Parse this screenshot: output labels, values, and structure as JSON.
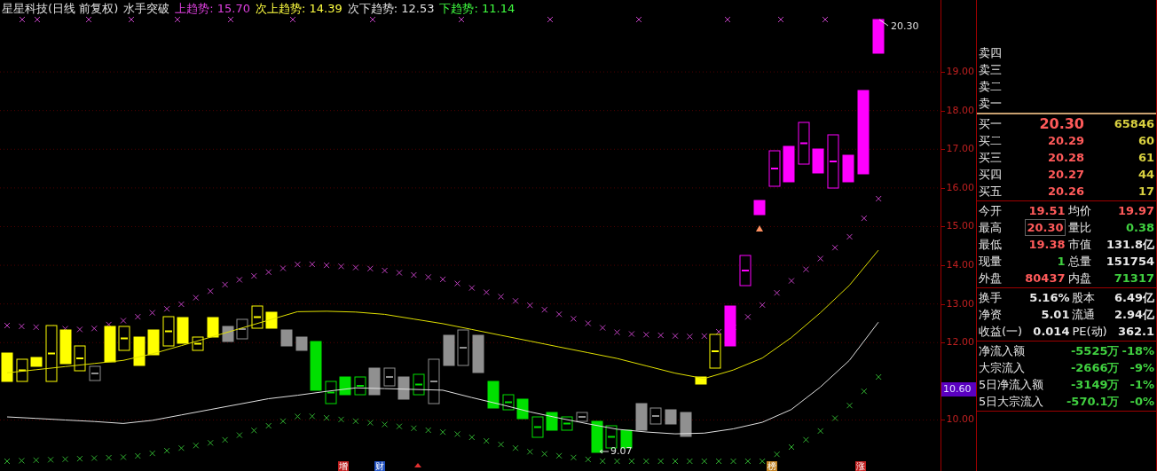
{
  "title": {
    "stock": "星星科技(日线 前复权)",
    "indicator": "水手突破",
    "legend": [
      {
        "text": "上趋势: 15.70",
        "color": "#e040e0"
      },
      {
        "text": "次上趋势: 14.39",
        "color": "#ffff40"
      },
      {
        "text": "次下趋势: 12.53",
        "color": "#e0e0e0"
      },
      {
        "text": "下趋势: 11.14",
        "color": "#40ff40"
      }
    ]
  },
  "chart": {
    "chart_data": {
      "type": "line",
      "grid": true,
      "ylim": [
        8.68,
        20.86
      ],
      "yticks": [
        {
          "value": 19,
          "label": "19.00"
        },
        {
          "value": 18,
          "label": "18.00"
        },
        {
          "value": 17,
          "label": "17.00"
        },
        {
          "value": 16,
          "label": "16.00"
        },
        {
          "value": 15,
          "label": "15.00"
        },
        {
          "value": 14,
          "label": "14.00"
        },
        {
          "value": 13,
          "label": "13.00"
        },
        {
          "value": 12,
          "label": "12.00"
        },
        {
          "value": 10,
          "label": "10.00"
        }
      ],
      "categories": [
        null,
        null,
        null,
        null,
        null,
        null,
        null,
        null,
        null,
        null,
        null,
        null,
        null,
        null,
        null,
        null,
        null,
        null,
        null,
        null,
        null,
        null,
        null,
        null,
        null,
        null,
        null,
        null,
        null,
        null,
        null
      ],
      "series": [
        {
          "color": "#e0e000",
          "values": [
            11.22,
            11.3,
            11.38,
            11.46,
            11.54,
            11.71,
            11.92,
            12.14,
            12.36,
            12.58,
            12.8,
            12.81,
            12.79,
            12.73,
            12.61,
            12.49,
            12.34,
            12.19,
            12.04,
            11.89,
            11.74,
            11.59,
            11.4,
            11.21,
            11.07,
            11.29,
            11.6,
            12.13,
            12.77,
            13.48,
            14.39
          ]
        },
        {
          "color": "#e0e0e0",
          "values": [
            10.08,
            10.04,
            10.0,
            9.96,
            9.91,
            9.99,
            10.13,
            10.27,
            10.41,
            10.55,
            10.64,
            10.74,
            10.83,
            10.81,
            10.79,
            10.77,
            10.58,
            10.4,
            10.21,
            10.05,
            9.9,
            9.76,
            9.69,
            9.64,
            9.66,
            9.77,
            9.94,
            10.27,
            10.85,
            11.54,
            12.53
          ]
        }
      ]
    },
    "annotations": [
      {
        "text": "20.30",
        "kind": "high"
      },
      {
        "text": "9.07",
        "kind": "low"
      }
    ],
    "markers": [
      {
        "text": "增",
        "color": "#c02020"
      },
      {
        "text": "财",
        "color": "#2050c0"
      },
      {
        "text": "榜",
        "color": "#c08020"
      },
      {
        "text": "涨",
        "color": "#c02020"
      }
    ]
  },
  "price_axis": {
    "current_price": "10.60"
  },
  "quote": {
    "sell": [
      "卖四",
      "卖三",
      "卖二",
      "卖一"
    ],
    "buy": [
      {
        "label": "买一",
        "price": "20.30",
        "volume": "65846"
      },
      {
        "label": "买二",
        "price": "20.29",
        "volume": "60"
      },
      {
        "label": "买三",
        "price": "20.28",
        "volume": "61"
      },
      {
        "label": "买四",
        "price": "20.27",
        "volume": "44"
      },
      {
        "label": "买五",
        "price": "20.26",
        "volume": "17"
      }
    ],
    "stats": [
      {
        "label": "今开",
        "value": "19.51",
        "color": "#ff5a5a",
        "boxed": false
      },
      {
        "label": "均价",
        "value": "19.97",
        "color": "#ff5a5a",
        "boxed": false
      },
      {
        "label": "最高",
        "value": "20.30",
        "color": "#ff5a5a",
        "boxed": true
      },
      {
        "label": "量比",
        "value": "0.38",
        "color": "#40d040",
        "boxed": false
      },
      {
        "label": "最低",
        "value": "19.38",
        "color": "#ff5a5a",
        "boxed": false
      },
      {
        "label": "市值",
        "value": "131.8亿",
        "color": "#e8e8e8",
        "boxed": false
      },
      {
        "label": "现量",
        "value": "1",
        "color": "#40d040",
        "boxed": false
      },
      {
        "label": "总量",
        "value": "151754",
        "color": "#e8e8e8",
        "boxed": false
      },
      {
        "label": "外盘",
        "value": "80437",
        "color": "#ff5a5a",
        "boxed": false
      },
      {
        "label": "内盘",
        "value": "71317",
        "color": "#40d040",
        "boxed": false
      }
    ],
    "fundamentals": [
      {
        "label": "换手",
        "value": "5.16%"
      },
      {
        "label": "股本",
        "value": "6.49亿"
      },
      {
        "label": "净资",
        "value": "5.01"
      },
      {
        "label": "流通",
        "value": "2.94亿"
      },
      {
        "label": "收益(一)",
        "value": "0.014"
      },
      {
        "label": "PE(动)",
        "value": "362.1"
      }
    ],
    "flows": [
      {
        "label": "净流入额",
        "amount": "-5525万",
        "percent": "-18%"
      },
      {
        "label": "大宗流入",
        "amount": "-2666万",
        "percent": "-9%"
      },
      {
        "label": "5日净流入额",
        "amount": "-3149万",
        "percent": "-1%"
      },
      {
        "label": "5日大宗流入",
        "amount": "-570.1万",
        "percent": "-0%"
      }
    ]
  }
}
